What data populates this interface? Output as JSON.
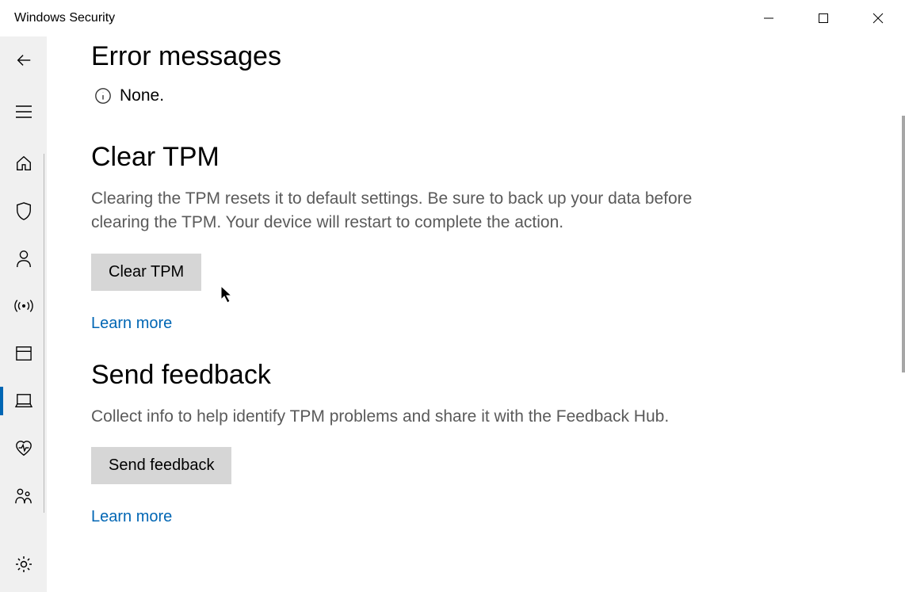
{
  "window": {
    "title": "Windows Security"
  },
  "sections": {
    "error": {
      "heading": "Error messages",
      "status": "None."
    },
    "clearTpm": {
      "heading": "Clear TPM",
      "desc": "Clearing the TPM resets it to default settings. Be sure to back up your data before clearing the TPM. Your device will restart to complete the action.",
      "button": "Clear TPM",
      "link": "Learn more"
    },
    "feedback": {
      "heading": "Send feedback",
      "desc": "Collect info to help identify TPM problems and share it with the Feedback Hub.",
      "button": "Send feedback",
      "link": "Learn more"
    }
  }
}
